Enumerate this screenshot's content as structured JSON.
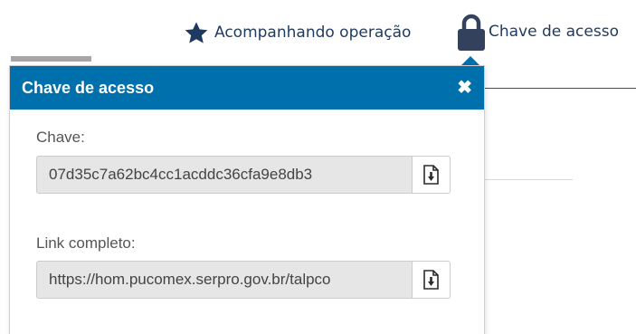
{
  "header": {
    "follow_link": {
      "label": "Acompanhando operação",
      "icon": "star-icon"
    },
    "key_link": {
      "label": "Chave de acesso",
      "icon": "lock-icon"
    }
  },
  "popover": {
    "title": "Chave de acesso",
    "close_glyph": "✖",
    "key_field": {
      "label": "Chave:",
      "value": "07d35c7a62bc4cc1acddc36cfa9e8db3"
    },
    "link_field": {
      "label": "Link completo:",
      "value": "https://hom.pucomex.serpro.gov.br/talpco"
    }
  },
  "colors": {
    "header_bg": "#0070ad",
    "link_text": "#1f3a5f",
    "input_bg": "#e6e6e6"
  }
}
